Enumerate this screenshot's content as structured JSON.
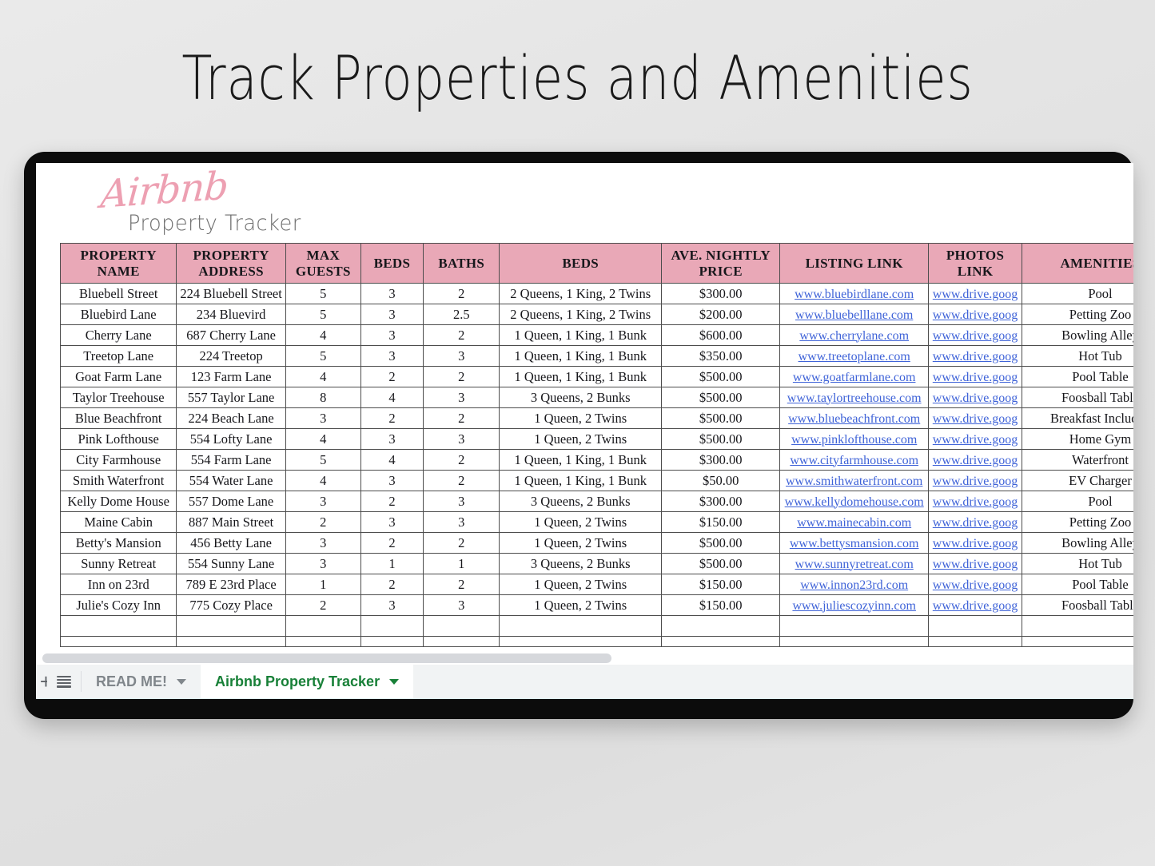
{
  "page": {
    "title": "Track Properties and Amenities",
    "background_color": "#e4e4e4"
  },
  "brand": {
    "script": "Airbnb",
    "subtitle": "Property Tracker",
    "script_color": "#eda0b2"
  },
  "spreadsheet": {
    "header_fill": "#e9a8b7",
    "link_color": "#3f63d8",
    "columns": [
      "PROPERTY NAME",
      "PROPERTY ADDRESS",
      "MAX GUESTS",
      "BEDS",
      "BATHS",
      "BEDS",
      "AVE. NIGHTLY PRICE",
      "LISTING LINK",
      "PHOTOS LINK",
      "AMENITIES"
    ],
    "rows": [
      {
        "name": "Bluebell Street",
        "address": "224 Bluebell Street",
        "guests": "5",
        "beds": "3",
        "baths": "2",
        "bed_config": "2 Queens, 1 King, 2 Twins",
        "price": "$300.00",
        "listing": "www.bluebirdlane.com",
        "photos": "www.drive.goog",
        "amenities": "Pool"
      },
      {
        "name": "Bluebird Lane",
        "address": "234 Bluevird",
        "guests": "5",
        "beds": "3",
        "baths": "2.5",
        "bed_config": "2 Queens, 1 King, 2 Twins",
        "price": "$200.00",
        "listing": "www.bluebelllane.com",
        "photos": "www.drive.goog",
        "amenities": "Petting Zoo"
      },
      {
        "name": "Cherry Lane",
        "address": "687 Cherry Lane",
        "guests": "4",
        "beds": "3",
        "baths": "2",
        "bed_config": "1 Queen, 1 King, 1 Bunk",
        "price": "$600.00",
        "listing": "www.cherrylane.com",
        "photos": "www.drive.goog",
        "amenities": "Bowling Alley"
      },
      {
        "name": "Treetop Lane",
        "address": "224 Treetop",
        "guests": "5",
        "beds": "3",
        "baths": "3",
        "bed_config": "1 Queen, 1 King, 1 Bunk",
        "price": "$350.00",
        "listing": "www.treetoplane.com",
        "photos": "www.drive.goog",
        "amenities": "Hot Tub"
      },
      {
        "name": "Goat Farm Lane",
        "address": "123 Farm Lane",
        "guests": "4",
        "beds": "2",
        "baths": "2",
        "bed_config": "1 Queen, 1 King, 1 Bunk",
        "price": "$500.00",
        "listing": "www.goatfarmlane.com",
        "photos": "www.drive.goog",
        "amenities": "Pool Table"
      },
      {
        "name": "Taylor Treehouse",
        "address": "557 Taylor Lane",
        "guests": "8",
        "beds": "4",
        "baths": "3",
        "bed_config": "3 Queens, 2 Bunks",
        "price": "$500.00",
        "listing": "www.taylortreehouse.com",
        "photos": "www.drive.goog",
        "amenities": "Foosball Table"
      },
      {
        "name": "Blue Beachfront",
        "address": "224 Beach Lane",
        "guests": "3",
        "beds": "2",
        "baths": "2",
        "bed_config": "1 Queen, 2 Twins",
        "price": "$500.00",
        "listing": "www.bluebeachfront.com",
        "photos": "www.drive.goog",
        "amenities": "Breakfast Included"
      },
      {
        "name": "Pink Lofthouse",
        "address": "554 Lofty Lane",
        "guests": "4",
        "beds": "3",
        "baths": "3",
        "bed_config": "1 Queen, 2 Twins",
        "price": "$500.00",
        "listing": "www.pinklofthouse.com",
        "photos": "www.drive.goog",
        "amenities": "Home Gym"
      },
      {
        "name": "City Farmhouse",
        "address": "554 Farm Lane",
        "guests": "5",
        "beds": "4",
        "baths": "2",
        "bed_config": "1 Queen, 1 King, 1 Bunk",
        "price": "$300.00",
        "listing": "www.cityfarmhouse.com",
        "photos": "www.drive.goog",
        "amenities": "Waterfront"
      },
      {
        "name": "Smith Waterfront",
        "address": "554 Water Lane",
        "guests": "4",
        "beds": "3",
        "baths": "2",
        "bed_config": "1 Queen, 1 King, 1 Bunk",
        "price": "$50.00",
        "listing": "www.smithwaterfront.com",
        "photos": "www.drive.goog",
        "amenities": "EV Charger"
      },
      {
        "name": "Kelly Dome House",
        "address": "557 Dome Lane",
        "guests": "3",
        "beds": "2",
        "baths": "3",
        "bed_config": "3 Queens, 2 Bunks",
        "price": "$300.00",
        "listing": "www.kellydomehouse.com",
        "photos": "www.drive.goog",
        "amenities": "Pool"
      },
      {
        "name": "Maine Cabin",
        "address": "887 Main Street",
        "guests": "2",
        "beds": "3",
        "baths": "3",
        "bed_config": "1 Queen, 2 Twins",
        "price": "$150.00",
        "listing": "www.mainecabin.com",
        "photos": "www.drive.goog",
        "amenities": "Petting Zoo"
      },
      {
        "name": "Betty's Mansion",
        "address": "456 Betty Lane",
        "guests": "3",
        "beds": "2",
        "baths": "2",
        "bed_config": "1 Queen, 2 Twins",
        "price": "$500.00",
        "listing": "www.bettysmansion.com",
        "photos": "www.drive.goog",
        "amenities": "Bowling Alley"
      },
      {
        "name": "Sunny Retreat",
        "address": "554 Sunny Lane",
        "guests": "3",
        "beds": "1",
        "baths": "1",
        "bed_config": "3 Queens, 2 Bunks",
        "price": "$500.00",
        "listing": "www.sunnyretreat.com",
        "photos": "www.drive.goog",
        "amenities": "Hot Tub"
      },
      {
        "name": "Inn on 23rd",
        "address": "789 E 23rd Place",
        "guests": "1",
        "beds": "2",
        "baths": "2",
        "bed_config": "1 Queen, 2 Twins",
        "price": "$150.00",
        "listing": "www.innon23rd.com",
        "photos": "www.drive.goog",
        "amenities": "Pool Table"
      },
      {
        "name": "Julie's Cozy Inn",
        "address": "775 Cozy Place",
        "guests": "2",
        "beds": "3",
        "baths": "3",
        "bed_config": "1 Queen, 2 Twins",
        "price": "$150.00",
        "listing": "www.juliescozyinn.com",
        "photos": "www.drive.goog",
        "amenities": "Foosball Table"
      }
    ]
  },
  "tabbar": {
    "add_sheet_label": "+",
    "all_sheets_icon": "hamburger-icon",
    "tabs": [
      {
        "label": "READ ME!",
        "active": false
      },
      {
        "label": "Airbnb Property Tracker",
        "active": true
      }
    ],
    "active_tab_color": "#188038",
    "inactive_tab_color": "#80868b"
  }
}
